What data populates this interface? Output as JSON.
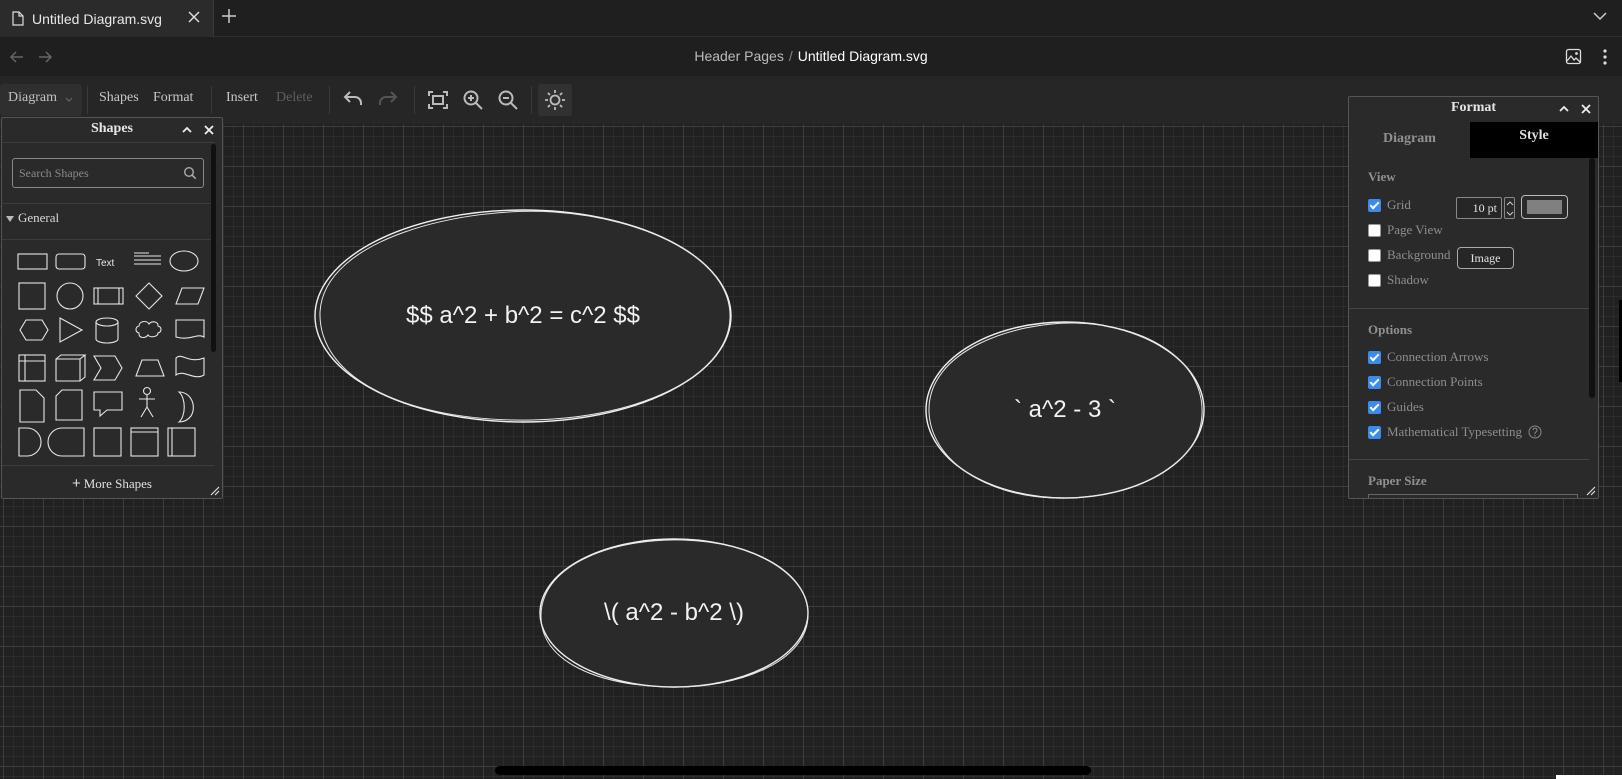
{
  "tab": {
    "title": "Untitled Diagram.svg"
  },
  "breadcrumb": {
    "parent": "Header Pages",
    "separator": "/",
    "current": "Untitled Diagram.svg"
  },
  "toolbar": {
    "diagram": "Diagram",
    "shapes": "Shapes",
    "format": "Format",
    "insert": "Insert",
    "delete": "Delete"
  },
  "canvas": {
    "shapes": [
      {
        "label": "$$ a^2 + b^2 = c^2 $$"
      },
      {
        "label": "` a^2 - 3 `"
      },
      {
        "label": "\\( a^2 - b^2 \\)"
      }
    ]
  },
  "shapes_panel": {
    "title": "Shapes",
    "search_placeholder": "Search Shapes",
    "section": "General",
    "more_shapes": "More Shapes",
    "text_shape_label": "Text"
  },
  "format_panel": {
    "title": "Format",
    "tabs": {
      "diagram": "Diagram",
      "style": "Style"
    },
    "view": {
      "title": "View",
      "grid": {
        "label": "Grid",
        "checked": true,
        "size": "10 pt",
        "color": "#808080"
      },
      "page_view": {
        "label": "Page View",
        "checked": false
      },
      "background": {
        "label": "Background",
        "checked": false,
        "button": "Image"
      },
      "shadow": {
        "label": "Shadow",
        "checked": false
      }
    },
    "options": {
      "title": "Options",
      "connection_arrows": {
        "label": "Connection Arrows",
        "checked": true
      },
      "connection_points": {
        "label": "Connection Points",
        "checked": true
      },
      "guides": {
        "label": "Guides",
        "checked": true
      },
      "math": {
        "label": "Mathematical Typesetting",
        "checked": true
      }
    },
    "paper_size": {
      "title": "Paper Size"
    }
  },
  "colors": {
    "background": "#1f1f1f",
    "canvas": "#212121",
    "accent": "#3b8be8",
    "shape_stroke": "#f0f0f0"
  }
}
